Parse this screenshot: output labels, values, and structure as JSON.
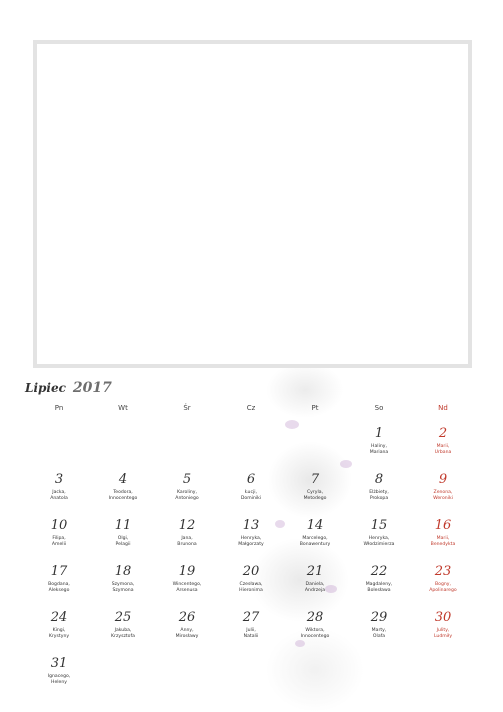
{
  "calendar": {
    "month": "Lipiec",
    "year": "2017",
    "weekdays": [
      "Pn",
      "Wt",
      "Śr",
      "Cz",
      "Pt",
      "So",
      "Nd"
    ],
    "days": [
      {
        "num": "1",
        "names": [
          "Haliny,",
          "Mariana"
        ]
      },
      {
        "num": "2",
        "names": [
          "Marii,",
          "Urbana"
        ]
      },
      {
        "num": "3",
        "names": [
          "Jacka,",
          "Anatola"
        ]
      },
      {
        "num": "4",
        "names": [
          "Teodora,",
          "Innocentego"
        ]
      },
      {
        "num": "5",
        "names": [
          "Karoliny,",
          "Antoniego"
        ]
      },
      {
        "num": "6",
        "names": [
          "Łucji,",
          "Dominiki"
        ]
      },
      {
        "num": "7",
        "names": [
          "Cyryla,",
          "Metodego"
        ]
      },
      {
        "num": "8",
        "names": [
          "Elżbiety,",
          "Prokopa"
        ]
      },
      {
        "num": "9",
        "names": [
          "Zenona,",
          "Weroniki"
        ]
      },
      {
        "num": "10",
        "names": [
          "Filipa,",
          "Amelii"
        ]
      },
      {
        "num": "11",
        "names": [
          "Olgi,",
          "Pelagii"
        ]
      },
      {
        "num": "12",
        "names": [
          "Jana,",
          "Brunona"
        ]
      },
      {
        "num": "13",
        "names": [
          "Henryka,",
          "Małgorzaty"
        ]
      },
      {
        "num": "14",
        "names": [
          "Marcelego,",
          "Bonawentury"
        ]
      },
      {
        "num": "15",
        "names": [
          "Henryka,",
          "Włodzimierza"
        ]
      },
      {
        "num": "16",
        "names": [
          "Marii,",
          "Benedykta"
        ]
      },
      {
        "num": "17",
        "names": [
          "Bogdana,",
          "Aleksego"
        ]
      },
      {
        "num": "18",
        "names": [
          "Szymona,",
          "Szymona"
        ]
      },
      {
        "num": "19",
        "names": [
          "Wincentego,",
          "Arsenusa"
        ]
      },
      {
        "num": "20",
        "names": [
          "Czesława,",
          "Hieronima"
        ]
      },
      {
        "num": "21",
        "names": [
          "Daniela,",
          "Andrzeja"
        ]
      },
      {
        "num": "22",
        "names": [
          "Magdaleny,",
          "Bolesława"
        ]
      },
      {
        "num": "23",
        "names": [
          "Bogny,",
          "Apolinarego"
        ]
      },
      {
        "num": "24",
        "names": [
          "Kingi,",
          "Krystyny"
        ]
      },
      {
        "num": "25",
        "names": [
          "Jakuba,",
          "Krzysztofa"
        ]
      },
      {
        "num": "26",
        "names": [
          "Anny,",
          "Mirosławy"
        ]
      },
      {
        "num": "27",
        "names": [
          "Julii,",
          "Natalii"
        ]
      },
      {
        "num": "28",
        "names": [
          "Wiktora,",
          "Innocentego"
        ]
      },
      {
        "num": "29",
        "names": [
          "Marty,",
          "Olafa"
        ]
      },
      {
        "num": "30",
        "names": [
          "Julity,",
          "Ludmiły"
        ]
      },
      {
        "num": "31",
        "names": [
          "Ignacego,",
          "Heleny"
        ]
      }
    ]
  },
  "colors": {
    "sunday": "#c0392b",
    "text": "#333333",
    "frame": "#e3e3e3"
  }
}
